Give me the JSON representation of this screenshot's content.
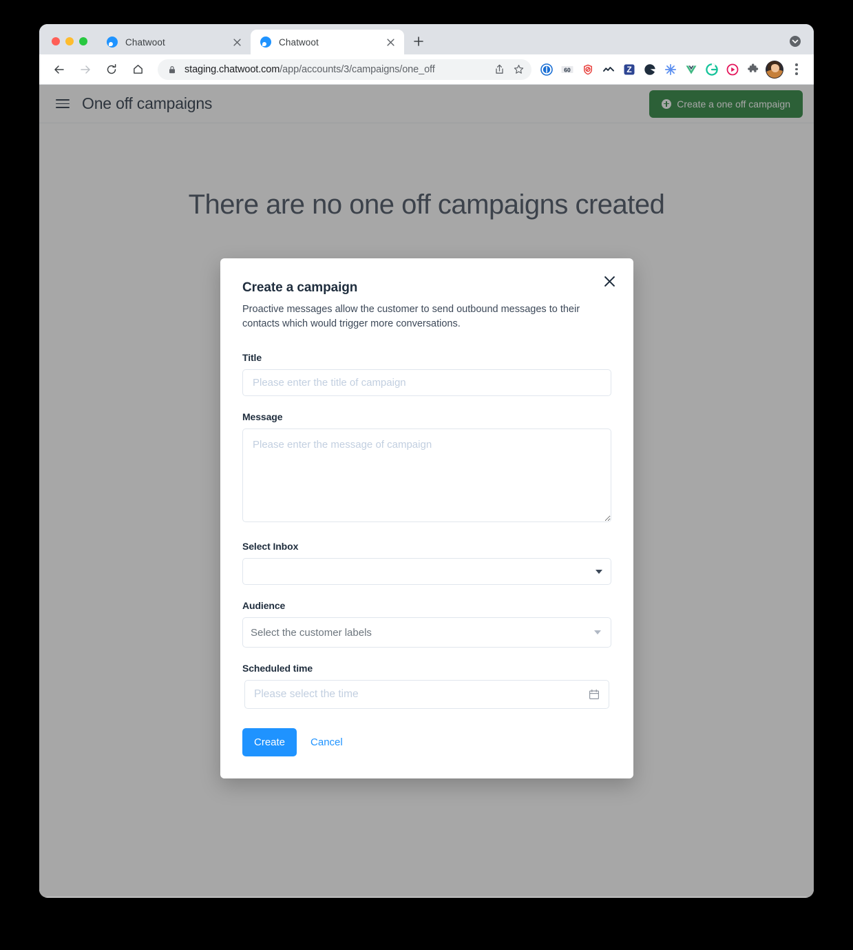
{
  "browser": {
    "traffic_lights": [
      "close",
      "minimize",
      "zoom"
    ],
    "tabs": [
      {
        "title": "Chatwoot",
        "active": false
      },
      {
        "title": "Chatwoot",
        "active": true
      }
    ],
    "new_tab_label": "+",
    "toolbar": {
      "back_label": "Back",
      "forward_label": "Forward",
      "reload_label": "Reload",
      "home_label": "Home",
      "url": "staging.chatwoot.com/app/accounts/3/campaigns/one_off",
      "url_domain": "staging.chatwoot.com",
      "url_path": "/app/accounts/3/campaigns/one_off",
      "share_label": "Share",
      "bookmark_label": "Bookmark this tab",
      "profile_label": "Profile",
      "menu_label": "Customize and control Google Chrome"
    },
    "extensions": [
      {
        "name": "1password-extension",
        "glyph": "①"
      },
      {
        "name": "grammar-extension",
        "glyph": "60"
      },
      {
        "name": "shield-extension",
        "glyph": "shield"
      },
      {
        "name": "chevron-extension",
        "glyph": "^^"
      },
      {
        "name": "zoom-extension",
        "glyph": "Z"
      },
      {
        "name": "clockify-extension",
        "glyph": "circle"
      },
      {
        "name": "asterisk-extension",
        "glyph": "✳"
      },
      {
        "name": "vue-devtools-extension",
        "glyph": "V"
      },
      {
        "name": "grammarly-extension",
        "glyph": "G"
      },
      {
        "name": "loom-extension",
        "glyph": "▶"
      },
      {
        "name": "extensions-puzzle-icon",
        "glyph": "puzzle"
      }
    ]
  },
  "app": {
    "title": "One off campaigns",
    "create_button": "Create a one off campaign",
    "empty_state": "There are no one off campaigns created"
  },
  "modal": {
    "title": "Create a campaign",
    "subtitle": "Proactive messages allow the customer to send outbound messages to their contacts which would trigger more conversations.",
    "close_label": "Close",
    "fields": {
      "title": {
        "label": "Title",
        "placeholder": "Please enter the title of campaign",
        "value": ""
      },
      "message": {
        "label": "Message",
        "placeholder": "Please enter the message of campaign",
        "value": ""
      },
      "inbox": {
        "label": "Select Inbox",
        "value": "",
        "options": [
          ""
        ]
      },
      "audience": {
        "label": "Audience",
        "placeholder": "Select the customer labels",
        "value": ""
      },
      "scheduled_time": {
        "label": "Scheduled time",
        "placeholder": "Please select the time",
        "value": ""
      }
    },
    "submit_label": "Create",
    "cancel_label": "Cancel"
  },
  "colors": {
    "brand_blue": "#1f93ff",
    "success_green": "#1f7e34",
    "text_dark": "#1f2d3d",
    "placeholder": "#c2cfe0",
    "border": "#e0e6ed",
    "overlay": "rgba(60,60,60,0.45)"
  }
}
